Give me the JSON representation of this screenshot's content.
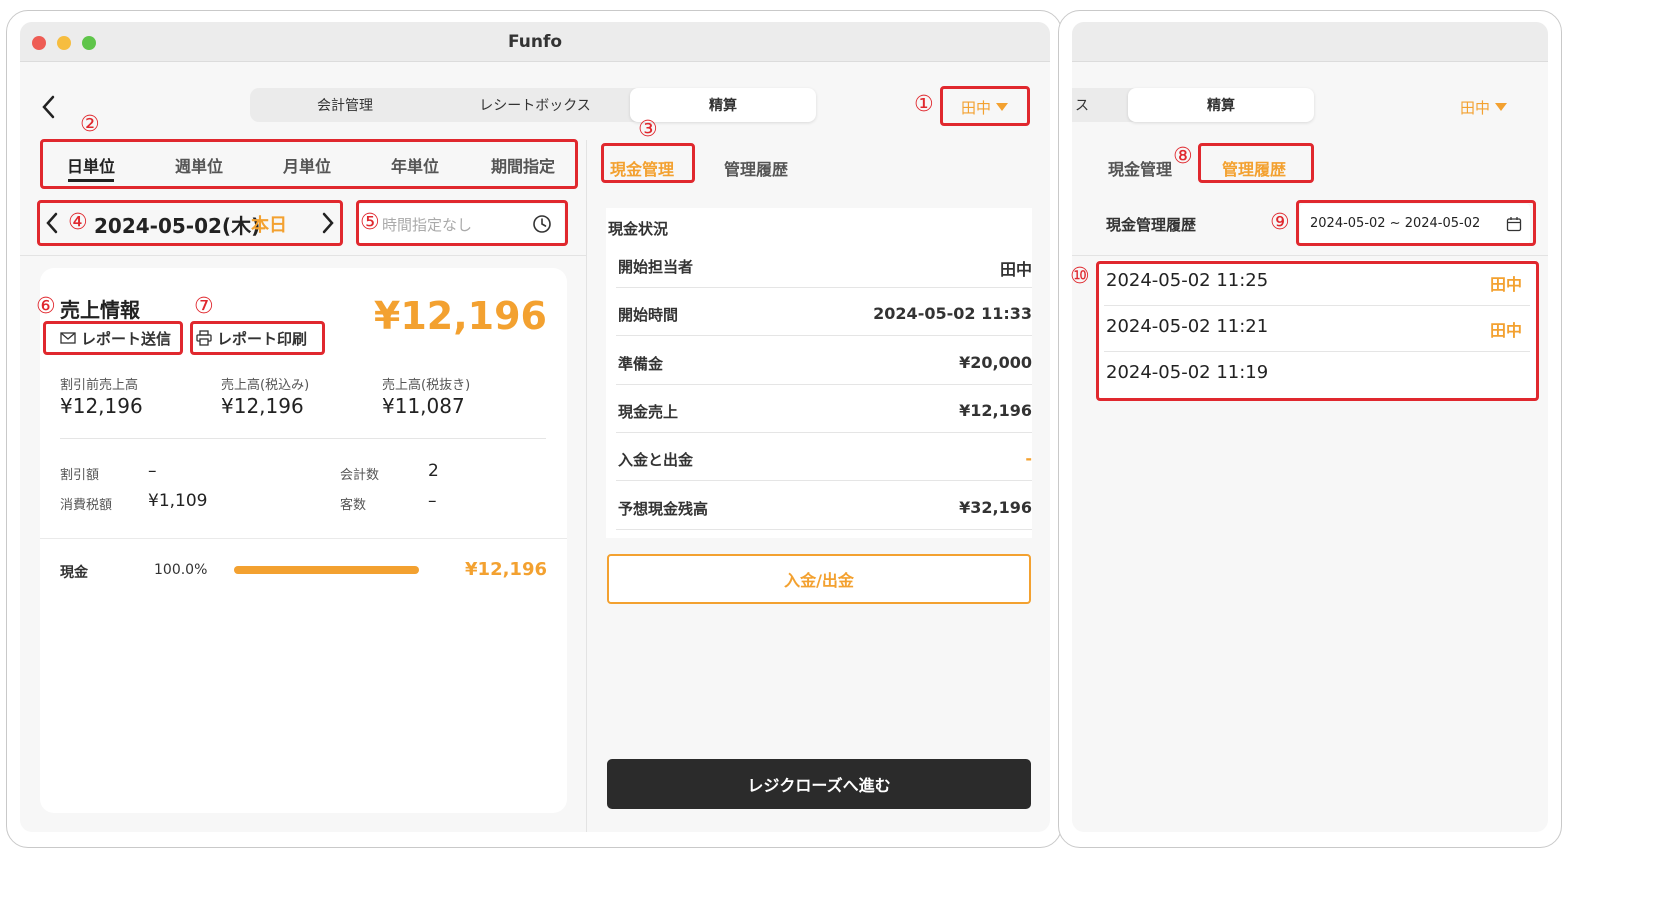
{
  "window": {
    "title": "Funfo",
    "traffic_colors": {
      "close": "#ee5c54",
      "minimize": "#f6bd3f",
      "zoom": "#5fc54a"
    }
  },
  "top_tabs": [
    {
      "label": "会計管理",
      "active": false
    },
    {
      "label": "レシートボックス",
      "active": false
    },
    {
      "label": "精算",
      "active": true
    }
  ],
  "user_menu": {
    "label": "田中"
  },
  "period_tabs": [
    {
      "label": "日単位",
      "active": true
    },
    {
      "label": "週単位",
      "active": false
    },
    {
      "label": "月単位",
      "active": false
    },
    {
      "label": "年単位",
      "active": false
    },
    {
      "label": "期間指定",
      "active": false
    }
  ],
  "date_nav": {
    "date": "2024-05-02(木)",
    "today_label": "本日"
  },
  "time_filter": {
    "placeholder": "時間指定なし"
  },
  "sales": {
    "title": "売上情報",
    "total": "¥12,196",
    "send_report": "レポート送信",
    "print_report": "レポート印刷",
    "metrics": [
      {
        "label": "割引前売上高",
        "value": "¥12,196"
      },
      {
        "label": "売上高(税込み)",
        "value": "¥12,196"
      },
      {
        "label": "売上高(税抜き)",
        "value": "¥11,087"
      }
    ],
    "details": [
      {
        "label": "割引額",
        "value": "–"
      },
      {
        "label": "会計数",
        "value": "2"
      },
      {
        "label": "消費税額",
        "value": "¥1,109"
      },
      {
        "label": "客数",
        "value": "–"
      }
    ],
    "payment": {
      "method": "現金",
      "percent": "100.0%",
      "fraction": 1.0,
      "amount": "¥12,196"
    }
  },
  "cash_tabs": {
    "management": "現金管理",
    "history": "管理履歴"
  },
  "cash_status": {
    "title": "現金状況",
    "rows": [
      {
        "label": "開始担当者",
        "value": "田中"
      },
      {
        "label": "開始時間",
        "value": "2024-05-02 11:33"
      },
      {
        "label": "準備金",
        "value": "¥20,000"
      },
      {
        "label": "現金売上",
        "value": "¥12,196"
      },
      {
        "label": "入金と出金",
        "value": "-"
      },
      {
        "label": "予想現金残高",
        "value": "¥32,196"
      }
    ],
    "deposit_button": "入金/出金",
    "close_button": "レジクローズへ進む"
  },
  "right_panel": {
    "tab_fragment": "ス",
    "active_tab": "精算",
    "user_label": "田中",
    "sub_tabs": {
      "management": "現金管理",
      "history": "管理履歴"
    },
    "history_title": "現金管理履歴",
    "date_range": "2024-05-02 ~ 2024-05-02",
    "entries": [
      {
        "time": "2024-05-02 11:25",
        "user": "田中"
      },
      {
        "time": "2024-05-02 11:21",
        "user": "田中"
      },
      {
        "time": "2024-05-02 11:19",
        "user": ""
      }
    ]
  },
  "annotations": [
    "①",
    "②",
    "③",
    "④",
    "⑤",
    "⑥",
    "⑦",
    "⑧",
    "⑨",
    "⑩"
  ],
  "colors": {
    "accent": "#f3a130",
    "annotation_red": "#e0282e",
    "dark_button": "#2b2b2b"
  }
}
